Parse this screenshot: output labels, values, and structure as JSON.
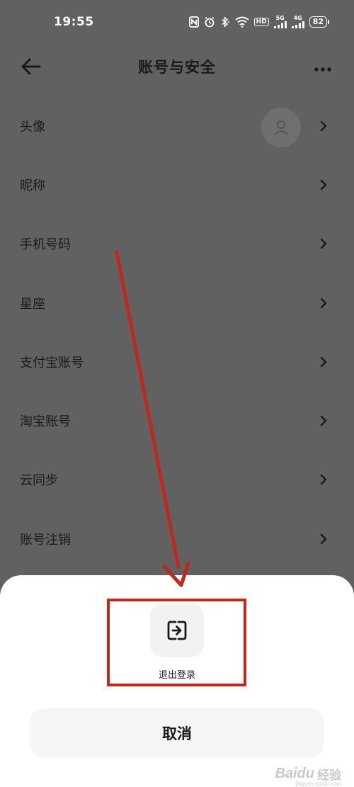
{
  "status_bar": {
    "time": "19:55",
    "signal_5g": "5G",
    "signal_4g": "4G",
    "hd": "HD",
    "battery": "82"
  },
  "header": {
    "title": "账号与安全"
  },
  "list": {
    "items": [
      {
        "label": "头像"
      },
      {
        "label": "昵称"
      },
      {
        "label": "手机号码"
      },
      {
        "label": "星座"
      },
      {
        "label": "支付宝账号"
      },
      {
        "label": "淘宝账号"
      },
      {
        "label": "云同步"
      },
      {
        "label": "账号注销"
      }
    ]
  },
  "sheet": {
    "logout_label": "退出登录",
    "cancel_label": "取消"
  },
  "watermark": {
    "brand": "Baidu",
    "cn": "经验",
    "sub": "jingyan.baidu.com"
  },
  "colors": {
    "dim_overlay": "#616161",
    "annotation_red": "#c0281c",
    "sheet_bg": "#ffffff"
  }
}
